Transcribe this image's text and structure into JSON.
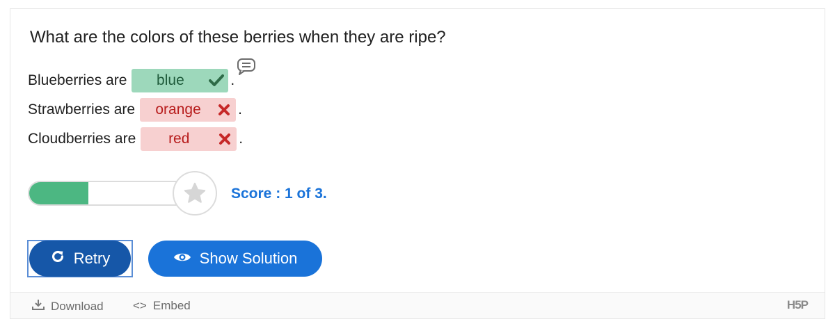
{
  "question": "What are the colors of these berries when they are ripe?",
  "sentences": [
    {
      "prefix": "Blueberries are",
      "answer": "blue",
      "status": "correct",
      "suffix": "."
    },
    {
      "prefix": "Strawberries are",
      "answer": "orange",
      "status": "wrong",
      "suffix": "."
    },
    {
      "prefix": "Cloudberries are",
      "answer": "red",
      "status": "wrong",
      "suffix": "."
    }
  ],
  "score": {
    "text": "Score : 1 of 3.",
    "value": 1,
    "max": 3
  },
  "buttons": {
    "retry": "Retry",
    "show_solution": "Show Solution"
  },
  "footer": {
    "download": "Download",
    "embed": "Embed",
    "logo": "H5P"
  },
  "icons": {
    "tip": "speech-bubble-icon",
    "correct": "checkmark-icon",
    "wrong": "cross-icon",
    "star": "star-icon",
    "retry": "refresh-icon",
    "solution": "eye-icon",
    "download": "download-icon",
    "embed": "code-icon"
  },
  "colors": {
    "correct_bg": "#9dd8bb",
    "wrong_bg": "#f7d0d0",
    "score_fill": "#4cb782",
    "score_text": "#1a73d9",
    "retry_bg": "#1657a8",
    "solution_bg": "#1a73d9"
  }
}
